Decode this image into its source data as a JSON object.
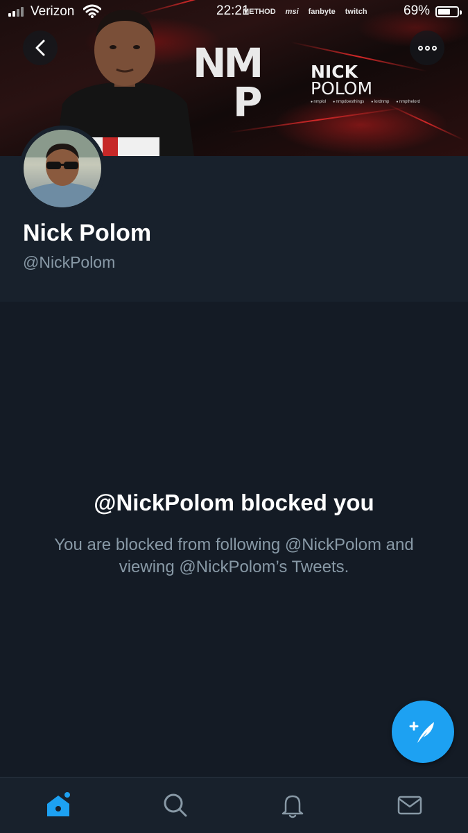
{
  "status_bar": {
    "carrier": "Verizon",
    "time": "22:21",
    "battery": "69%",
    "battery_level": 0.69,
    "banner_sponsors": [
      "METHOD",
      "msi",
      "fanbyte",
      "twitch"
    ]
  },
  "banner": {
    "logo_text": "NM",
    "logo_p": "P",
    "brand_line1": "NICK",
    "brand_line2": "POLOM",
    "socials": [
      "nmplol",
      "nmpdoesthings",
      "lordnmp",
      "nmpthelord"
    ]
  },
  "profile": {
    "display_name": "Nick Polom",
    "handle": "@NickPolom"
  },
  "blocked": {
    "title": "@NickPolom blocked you",
    "description": "You are blocked from following @NickPolom and viewing @NickPolom’s Tweets."
  },
  "icons": {
    "back": "chevron-left-icon",
    "more": "more-dots-icon",
    "compose": "compose-tweet-icon",
    "nav": [
      "home-icon",
      "search-icon",
      "notifications-icon",
      "messages-icon"
    ]
  },
  "colors": {
    "accent": "#1da1f2",
    "background": "#141b25",
    "surface": "#18212c",
    "secondary_text": "#8899a6"
  }
}
